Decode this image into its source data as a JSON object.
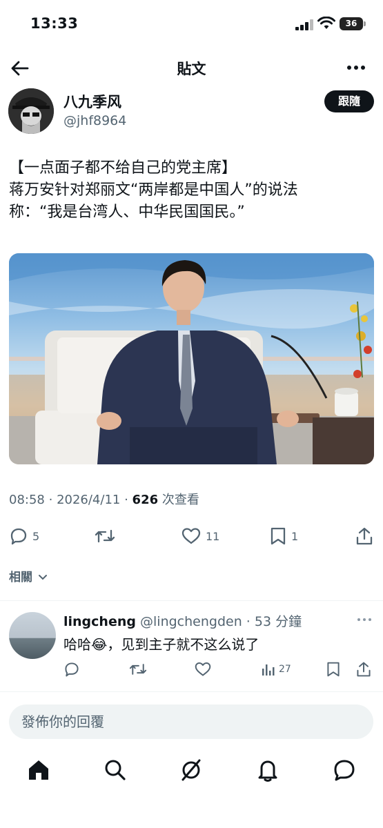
{
  "status_bar": {
    "time": "13:33",
    "battery": "36"
  },
  "header": {
    "title": "貼文"
  },
  "author": {
    "name": "八九季风",
    "handle": "@jhf8964",
    "follow_label": "跟隨"
  },
  "post": {
    "lines": [
      "【一点面子都不给自己的党主席】",
      "蒋万安针对郑丽文“两岸都是中国人”的说法",
      "称：“我是台湾人、中华民国国民。”"
    ],
    "time": "08:58",
    "date": "2026/4/11",
    "views": "626",
    "views_label": "次查看"
  },
  "actions": {
    "replies": "5",
    "retweets": "",
    "likes": "11",
    "bookmarks": "1"
  },
  "related_label": "相關",
  "reply": {
    "name": "lingcheng",
    "handle": "@lingchengden",
    "time": "53 分鐘",
    "text_before": "哈哈",
    "emoji": "😂",
    "text_after": "，见到主子就不这么说了",
    "views": "27"
  },
  "composer": {
    "placeholder": "發佈你的回覆"
  },
  "colors": {
    "text": "#0f1419",
    "muted": "#536471",
    "divider": "#eff3f4"
  }
}
